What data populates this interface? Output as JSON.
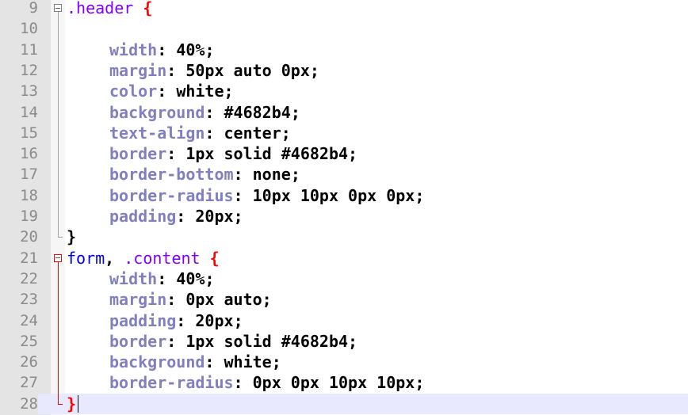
{
  "editor": {
    "lines": [
      {
        "num": "9",
        "selector": ".header",
        "brace": "{",
        "kind": "open"
      },
      {
        "num": "10",
        "kind": "blank"
      },
      {
        "num": "11",
        "prop": "width",
        "value": "40%",
        "kind": "decl"
      },
      {
        "num": "12",
        "prop": "margin",
        "value": "50px auto 0px",
        "kind": "decl"
      },
      {
        "num": "13",
        "prop": "color",
        "value": "white",
        "kind": "decl"
      },
      {
        "num": "14",
        "prop": "background",
        "value": "#4682b4",
        "kind": "decl"
      },
      {
        "num": "15",
        "prop": "text-align",
        "value": "center",
        "kind": "decl"
      },
      {
        "num": "16",
        "prop": "border",
        "value": "1px solid #4682b4",
        "kind": "decl"
      },
      {
        "num": "17",
        "prop": "border-bottom",
        "value": "none",
        "kind": "decl"
      },
      {
        "num": "18",
        "prop": "border-radius",
        "value": "10px 10px 0px 0px",
        "kind": "decl"
      },
      {
        "num": "19",
        "prop": "padding",
        "value": "20px",
        "kind": "decl"
      },
      {
        "num": "20",
        "brace": "}",
        "kind": "close"
      },
      {
        "num": "21",
        "tag": "form",
        "selector": ".content",
        "brace": "{",
        "kind": "open2"
      },
      {
        "num": "22",
        "prop": "width",
        "value": "40%",
        "kind": "decl"
      },
      {
        "num": "23",
        "prop": "margin",
        "value": "0px auto",
        "kind": "decl"
      },
      {
        "num": "24",
        "prop": "padding",
        "value": "20px",
        "kind": "decl"
      },
      {
        "num": "25",
        "prop": "border",
        "value": "1px solid #4682b4",
        "kind": "decl"
      },
      {
        "num": "26",
        "prop": "background",
        "value": "white",
        "kind": "decl"
      },
      {
        "num": "27",
        "prop": "border-radius",
        "value": "0px 0px 10px 10px",
        "kind": "decl"
      },
      {
        "num": "28",
        "brace": "}",
        "kind": "close_current"
      }
    ]
  },
  "colors": {
    "selector": "#8000ff",
    "tag": "#0000ff",
    "property": "#8080c0",
    "brace_match": "#ff0000",
    "current_line": "#e8e8ff",
    "gutter": "#e4e4e4"
  }
}
